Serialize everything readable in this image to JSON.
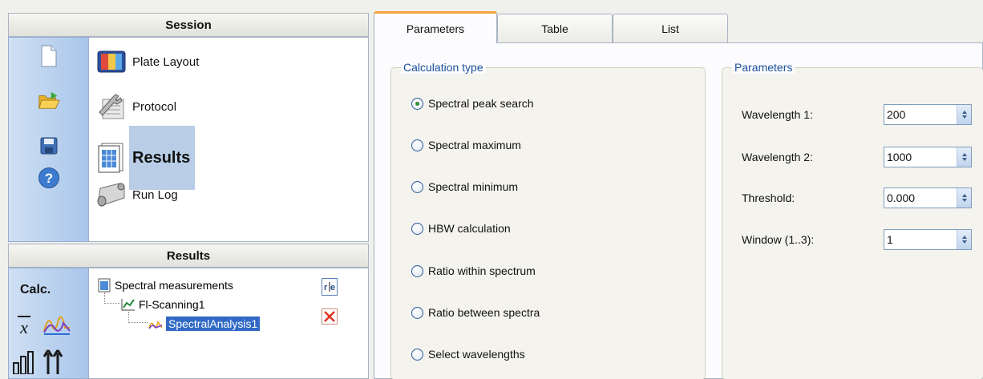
{
  "session": {
    "header": "Session",
    "toolbar_icons": [
      "new-document-icon",
      "open-folder-icon",
      "save-disk-icon",
      "help-icon"
    ],
    "nav": [
      {
        "label": "Plate Layout",
        "icon": "plate-layout-icon",
        "selected": false
      },
      {
        "label": "Protocol",
        "icon": "wrench-protocol-icon",
        "selected": false
      },
      {
        "label": "Results",
        "icon": "results-sheet-icon",
        "selected": true
      },
      {
        "label": "Run Log",
        "icon": "scroll-log-icon",
        "selected": false
      }
    ]
  },
  "results": {
    "header": "Results",
    "calc_label": "Calc.",
    "calc_icons": [
      "mean-x-bar-icon",
      "spectral-curve-icon",
      "bar-chart-icon",
      "peak-arrows-icon"
    ],
    "tree": {
      "root": "Spectral measurements",
      "child": "Fl-Scanning1",
      "leaf": "SpectralAnalysis1"
    },
    "side_buttons": [
      "rename-icon",
      "delete-icon"
    ]
  },
  "tabs": [
    {
      "label": "Parameters",
      "active": true
    },
    {
      "label": "Table",
      "active": false
    },
    {
      "label": "List",
      "active": false
    }
  ],
  "calc_type": {
    "title": "Calculation type",
    "options": [
      {
        "label": "Spectral peak search",
        "checked": true
      },
      {
        "label": "Spectral maximum",
        "checked": false
      },
      {
        "label": "Spectral minimum",
        "checked": false
      },
      {
        "label": "HBW calculation",
        "checked": false
      },
      {
        "label": "Ratio within spectrum",
        "checked": false
      },
      {
        "label": "Ratio between spectra",
        "checked": false
      },
      {
        "label": "Select wavelengths",
        "checked": false
      }
    ]
  },
  "parameters": {
    "title": "Parameters",
    "fields": [
      {
        "label": "Wavelength 1:",
        "value": "200"
      },
      {
        "label": "Wavelength 2:",
        "value": "1000"
      },
      {
        "label": "Threshold:",
        "value": "0.000"
      },
      {
        "label": "Window (1..3):",
        "value": "1"
      }
    ]
  },
  "colors": {
    "selection": "#316ac5",
    "nav_selected": "#b9cee6",
    "active_tab_accent": "#f2a33a",
    "group_title": "#1b4f9c"
  }
}
